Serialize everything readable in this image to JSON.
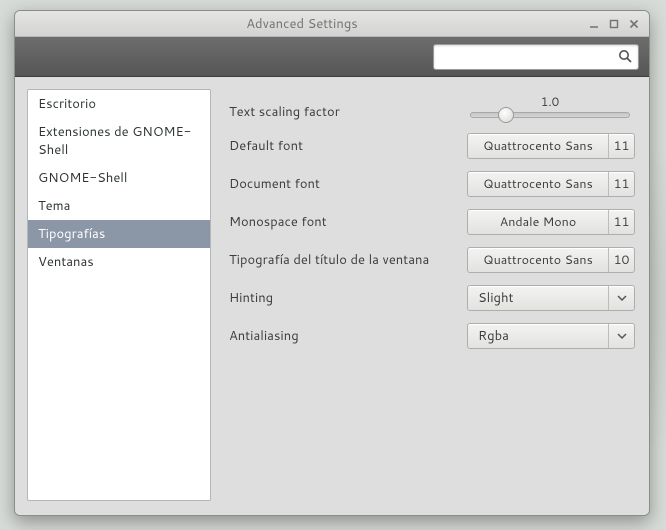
{
  "window": {
    "title": "Advanced Settings"
  },
  "search": {
    "placeholder": ""
  },
  "sidebar": {
    "items": [
      {
        "label": "Escritorio"
      },
      {
        "label": "Extensiones de GNOME-Shell"
      },
      {
        "label": "GNOME-Shell"
      },
      {
        "label": "Tema"
      },
      {
        "label": "Tipografías",
        "selected": true
      },
      {
        "label": "Ventanas"
      }
    ]
  },
  "settings": {
    "scaling": {
      "label": "Text scaling factor",
      "value": "1.0",
      "pos_pct": 22
    },
    "default": {
      "label": "Default font",
      "font": "Quattrocento Sans",
      "size": "11"
    },
    "document": {
      "label": "Document font",
      "font": "Quattrocento Sans",
      "size": "11"
    },
    "monospace": {
      "label": "Monospace font",
      "font": "Andale Mono",
      "size": "11"
    },
    "windowtitle": {
      "label": "Tipografía del título de la ventana",
      "font": "Quattrocento Sans",
      "size": "10"
    },
    "hinting": {
      "label": "Hinting",
      "value": "Slight"
    },
    "antialiasing": {
      "label": "Antialiasing",
      "value": "Rgba"
    }
  }
}
